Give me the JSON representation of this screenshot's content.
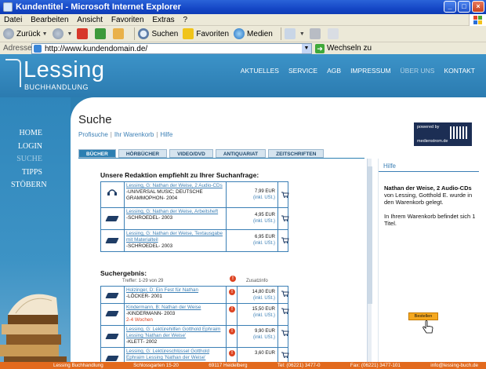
{
  "window": {
    "title": "Kundentitel - Microsoft Internet Explorer",
    "buttons": [
      "_",
      "□",
      "×"
    ]
  },
  "menu": [
    "Datei",
    "Bearbeiten",
    "Ansicht",
    "Favoriten",
    "Extras",
    "?"
  ],
  "toolbar": {
    "back": "Zurück",
    "search": "Suchen",
    "favorites": "Favoriten",
    "media": "Medien"
  },
  "address": {
    "label": "Adresse",
    "url": "http://www.kundendomain.de/",
    "go": "Wechseln zu"
  },
  "site": {
    "logo": "Lessing",
    "logo_sub": "BUCHHANDLUNG",
    "topnav": [
      "AKTUELLES",
      "SERVICE",
      "AGB",
      "IMPRESSUM",
      "ÜBER UNS",
      "KONTAKT"
    ],
    "sidenav": [
      "HOME",
      "LOGIN",
      "SUCHE",
      "TIPPS",
      "STÖBERN"
    ]
  },
  "page": {
    "title": "Suche",
    "links": [
      "Profisuche",
      "Ihr Warenkorb",
      "Hilfe"
    ],
    "brand": "powered by",
    "brand_sub": "medienstrom.de",
    "tabs": [
      "BÜCHER",
      "HÖRBÜCHER",
      "VIDEO/DVD",
      "ANTIQUARIAT",
      "ZEITSCHRIFTEN"
    ],
    "recommend_heading": "Unsere Redaktion empfiehlt zu Ihrer Suchanfrage:",
    "recommendations": [
      {
        "title": "Lessing, G: Nathan der Weise, 2 Audio-CDs",
        "meta": "-UNIVERSAL MUSIC; DEUTSCHE GRAMMOPHON- 2004",
        "price": "7,99 EUR",
        "vat": "(inkl. USt.)",
        "type": "cd"
      },
      {
        "title": "Lessing, G: Nathan der Weise, Arbeitsheft",
        "meta": "-SCHROEDEL- 2003",
        "price": "4,95 EUR",
        "vat": "(inkl. USt.)",
        "type": "book"
      },
      {
        "title": "Lessing, G: Nathan der Weise, Textausgabe mit Materialteil",
        "meta": "-SCHROEDEL- 2003",
        "price": "6,95 EUR",
        "vat": "(inkl. USt.)",
        "type": "book"
      }
    ],
    "results_heading": "Suchergebnis:",
    "results_info": "Treffer: 1-29 von 29",
    "results_extra": "Zusatzinfo",
    "results": [
      {
        "title": "Holzinger, D: Ein Fest für Nathan",
        "meta": "-LÖCKER- 2001",
        "red": "",
        "price": "14,80 EUR",
        "vat": "(inkl. USt.)"
      },
      {
        "title": "Kindermann, B: Nathan der Weise",
        "meta": "-KINDERMANN- 2003",
        "red": "2-4 Wochen",
        "price": "15,50 EUR",
        "vat": "(inkl. USt.)"
      },
      {
        "title": "Lessing, G: Lektürehilfen Gotthold Ephraim Lessing 'Nathan der Weise'",
        "meta": "-KLETT- 2002",
        "red": "",
        "price": "9,90 EUR",
        "vat": "(inkl. USt.)"
      },
      {
        "title": "Lessing, G: Lektüreschlüssel Gotthold Ephraim Lessing 'Nathan der Weise'",
        "meta": "",
        "red": "",
        "price": "3,60 EUR",
        "vat": ""
      }
    ]
  },
  "help": {
    "title": "Hilfe",
    "product": "Nathan der Weise, 2 Audio-CDs",
    "line1": "von Lessing, Gotthold E. wurde in den Warenkorb gelegt.",
    "line2": "In Ihrem Warenkorb befindet sich 1 Titel.",
    "button": "Bestellen"
  },
  "footer": [
    "Lessing Buchhandlung",
    "Schlossgarten 15-20",
    "69117 Heidelberg",
    "Tel: (06221) 3477-0",
    "Fax: (06221) 3477-101",
    "info@lessing-buch.de"
  ],
  "colors": {
    "brand_blue": "#2c7fb2",
    "link": "#3b7fb5",
    "footer": "#e26a1e",
    "order_button": "#f5a820",
    "alert": "#dd4422"
  }
}
